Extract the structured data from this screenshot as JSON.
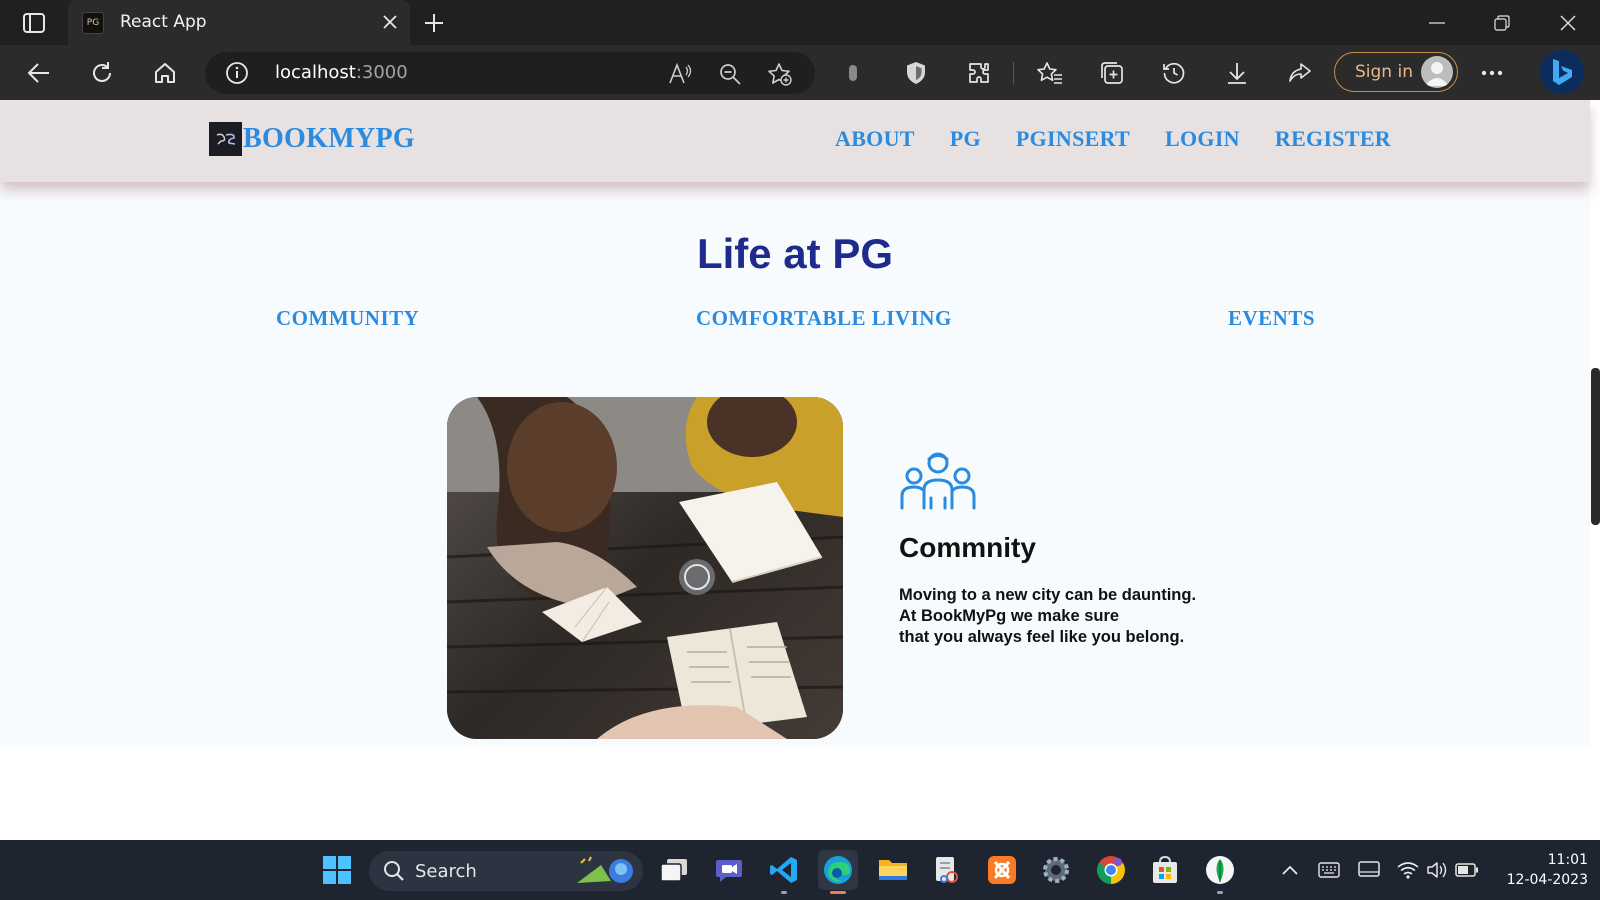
{
  "browser": {
    "tab_title": "React App",
    "favicon_text": "PG",
    "address_host": "localhost",
    "address_port": ":3000",
    "signin_label": "Sign in"
  },
  "navbar": {
    "brand": "BOOKMYPG",
    "links": [
      "ABOUT",
      "PG",
      "PGINSERT",
      "LOGIN",
      "REGISTER"
    ]
  },
  "main": {
    "title": "Life at PG",
    "section_tabs": [
      "COMMUNITY",
      "COMFORTABLE LIVING",
      "EVENTS"
    ],
    "feature": {
      "icon": "people-group-icon",
      "title": "Commnity",
      "description_lines": [
        "Moving to a new city can be daunting.",
        "At BookMyPg we make sure",
        "that you always feel like you belong."
      ]
    }
  },
  "taskbar": {
    "search_label": "Search",
    "time": "11:01",
    "date": "12-04-2023"
  },
  "colors": {
    "accent_link": "#2a8be0",
    "title": "#1e2a8c",
    "navbar_bg": "#e7e1e1",
    "signin_border": "#c98f4a"
  }
}
